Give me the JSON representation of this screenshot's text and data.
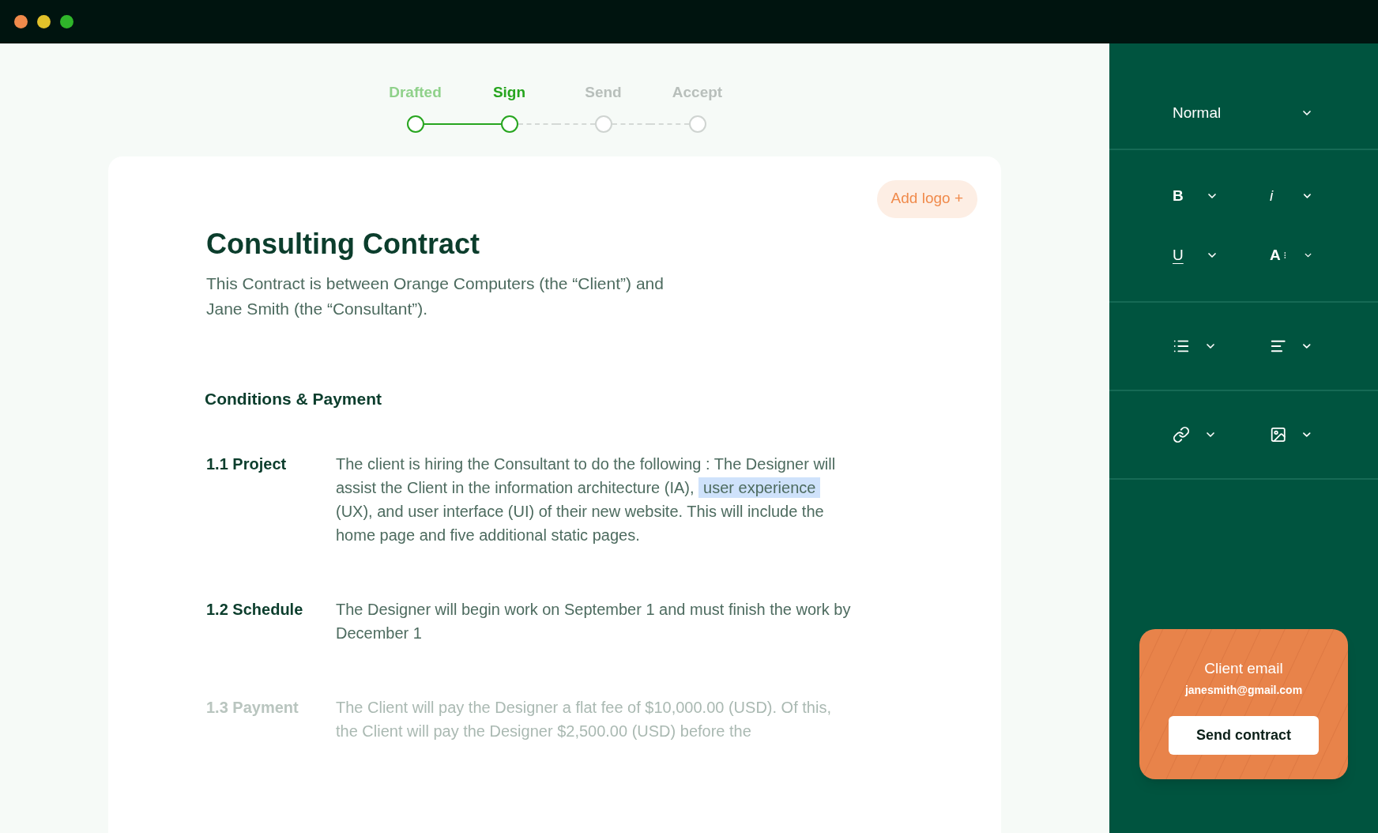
{
  "stepper": [
    {
      "label": "Drafted",
      "completed": true,
      "selected": false
    },
    {
      "label": "Sign",
      "completed": false,
      "selected": true
    },
    {
      "label": "Send",
      "completed": false,
      "selected": false
    },
    {
      "label": "Accept",
      "completed": false,
      "selected": false
    }
  ],
  "document": {
    "add_logo": "Add logo +",
    "title": "Consulting Contract",
    "intro": "This Contract is between Orange Computers (the “Client”) and Jane Smith (the “Consultant”).",
    "section_heading": "Conditions & Payment",
    "clauses": [
      {
        "label": "1.1 Project",
        "faded": false,
        "before": "The client is hiring the Consultant to do the following : The Designer will assist the Client in the information architecture (IA), ",
        "highlight": "user experience",
        "after": " (UX), and user interface (UI) of their new website. This will include the home page and five additional static pages."
      },
      {
        "label": "1.2 Schedule",
        "faded": false,
        "before": "The Designer will begin work on September 1 and must finish the work by December 1"
      },
      {
        "label": "1.3 Payment",
        "faded": true,
        "before": "The Client will pay the Designer a flat fee of $10,000.00 (USD). Of this, the Client will pay the Designer $2,500.00 (USD) before the"
      }
    ]
  },
  "toolbar": {
    "style_select": "Normal",
    "groups": [
      {
        "tools": [
          {
            "kind": "text",
            "label": "B"
          },
          {
            "kind": "text",
            "label": "i"
          },
          {
            "kind": "text",
            "label": "U"
          },
          {
            "kind": "text",
            "label": "A"
          }
        ]
      },
      {
        "tools": [
          {
            "kind": "icon"
          },
          {
            "kind": "icon"
          }
        ]
      },
      {
        "tools": [
          {
            "kind": "icon"
          },
          {
            "kind": "icon"
          }
        ]
      }
    ]
  },
  "send_card": {
    "title": "Client email",
    "email": "janesmith@gmail.com",
    "button": "Send contract"
  }
}
